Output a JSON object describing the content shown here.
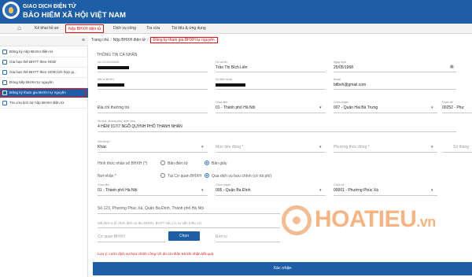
{
  "header": {
    "top_line": "GIAO DỊCH ĐIỆN TỬ",
    "main_line": "BẢO HIỂM XÃ HỘI VIỆT NAM"
  },
  "menu": {
    "items": [
      "Kê khai hồ sơ",
      "Nộp BHXH điện tử",
      "Dịch vụ công",
      "Tra cứu",
      "Tài liệu & ứng dụng"
    ]
  },
  "sidebar": {
    "items": [
      "Đăng ký nộp BHXH điện tử",
      "Gia hạn thẻ BHYT theo HGĐ",
      "Gia hạn thẻ BHYT theo HGĐ tích hợp gi...",
      "Đóng tiếp BHXH tự nguyện",
      "Đăng ký tham gia BHXH tự nguyện",
      "Tra cứu lịch sử nộp BHXH điện tử"
    ]
  },
  "breadcrumb": {
    "home": "Trang chủ",
    "parent": "Nộp BHXH điện tử",
    "current": "Đăng ký tham gia BHXH tự nguyện"
  },
  "form": {
    "section_title": "THÔNG TIN CÁ NHÂN",
    "so_cccd_label": "Số CCCD/CMND",
    "ho_ten_label": "Họ và tên",
    "ho_ten_value": "Trần Thị Bích Liên",
    "ngay_sinh_label": "Ngày sinh",
    "ngay_sinh_value": "25/05/1968",
    "ma_so_bhxh_label": "Mã số BHXH",
    "so_dien_thoai_label": "Số điện thoại",
    "email_label": "Email",
    "email_value": "btlbvh@gmail.com",
    "dia_chi_thuong_tru_label": "Địa chỉ thường trú",
    "tinh_label": "Chọn tỉnh",
    "tinh_value": "01 - Thành phố Hà Nội",
    "huyen_label": "Chọn huyện",
    "huyen_value": "007 - Quận Hai Bà Trưng",
    "xa_label": "Chọn xã",
    "xa_value": "00252 - Phư",
    "so_nha_label": "Số nhà, đường phố, thôn xóm",
    "so_nha_value": "4 HẺM 317/7 NGÕ QUỲNH PHỐ THANH NHÀN",
    "noi_dung_label": "Nội dung *",
    "noi_dung_value": "Khác",
    "muc_tien_dong_placeholder": "Mức tiền đóng *",
    "phuong_thuc_dong_placeholder": "Phương thức đóng *",
    "so_thang_placeholder": "Số tháng",
    "hinh_thuc_nhan_label": "Hình thức nhận sổ BHXH (*)",
    "ban_dien_tu": "Bản điện tử",
    "ban_giay": "Bản giấy",
    "noi_nhan_label": "Nơi nhận *",
    "tai_co_quan": "Tại Cơ quan BHXH",
    "qua_buu_chinh": "Qua dịch vụ bưu chính (có trả phí)",
    "nhan_tinh_label": "Chọn tỉnh",
    "nhan_tinh_value": "01 - Thành phố Hà Nội",
    "nhan_huyen_label": "Chọn huyện",
    "nhan_huyen_value": "005 - Quận Ba Đình",
    "nhan_xa_label": "Chọn xã",
    "nhan_xa_value": "00001 - Phường Phúc Xá",
    "dia_chi_nhan_value": "Số 123, Phường Phúc Xá, Quận Ba Đình, Thành phố Hà Nội",
    "ma_don_vi_placeholder": "Mã đơn vị tổ chức dịch vụ thu BHXH, BHYT nếu có, tư vấn (nếu có)",
    "co_quan_bhxh_placeholder": "Cơ quan BHXH",
    "chon_button": "Chọn",
    "dem_so_placeholder": "Đơn vị",
    "warning": "Lưu ý: cước dịch vụ bưu chính công ích do cá nhân trả khi nhận kết quả",
    "submit": "Xác nhận"
  },
  "watermark": {
    "brand": "HOATIEU",
    "suffix": ".vn"
  },
  "colors": {
    "primary": "#1e5ea7",
    "highlight": "#dd1111",
    "watermark": "#f39b5a"
  }
}
